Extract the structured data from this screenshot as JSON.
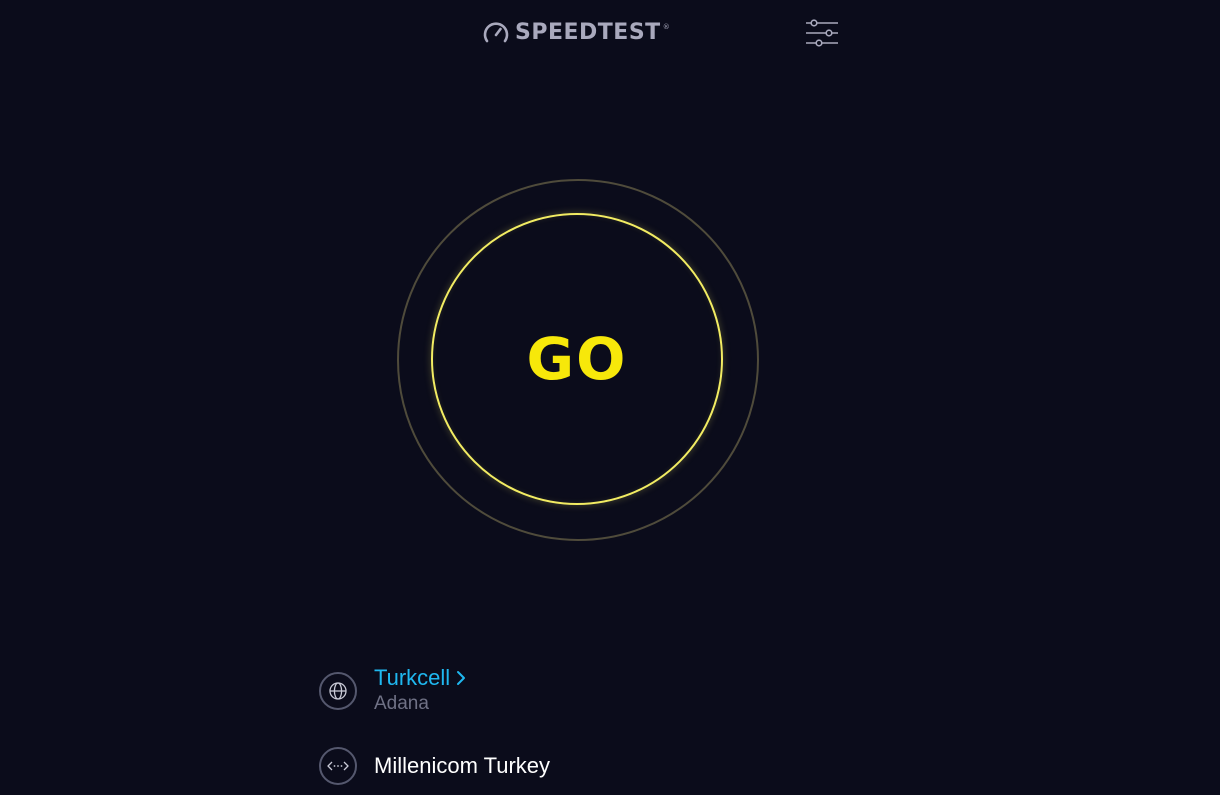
{
  "header": {
    "logo_text": "SPEEDTEST",
    "logo_trademark": "®",
    "settings_icon": "sliders-icon"
  },
  "go_button": {
    "label": "GO"
  },
  "connection": {
    "isp_name": "Turkcell",
    "isp_location": "Adana",
    "isp_icon": "globe-icon",
    "host_name": "Millenicom Turkey",
    "host_icon": "server-icon"
  },
  "colors": {
    "background": "#0b0c1b",
    "go_accent": "#f7e80a",
    "ring_inner": "#f2ec63",
    "ring_outer": "#4f4b3b",
    "link": "#1fb8f0",
    "muted_text": "#6f7185",
    "logo": "#a9a9bd"
  }
}
